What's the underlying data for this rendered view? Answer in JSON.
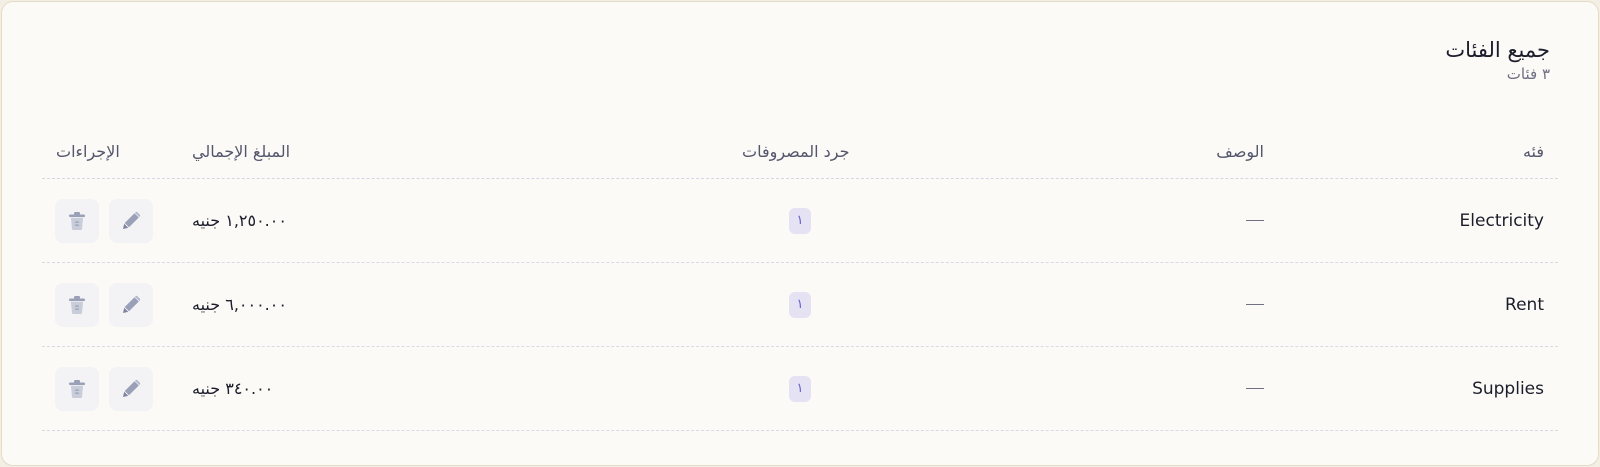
{
  "header": {
    "title": "جميع الفئات",
    "subtitle": "٣ فئات"
  },
  "table": {
    "columns": {
      "category": "فئه",
      "description": "الوصف",
      "expense_count": "جرد المصروفات",
      "total_amount": "المبلغ الإجمالي",
      "actions": "الإجراءات"
    },
    "rows": [
      {
        "category": "Electricity",
        "description": "—",
        "expense_count": "١",
        "total_amount": "١,٢٥٠.٠٠ جنيه"
      },
      {
        "category": "Rent",
        "description": "—",
        "expense_count": "١",
        "total_amount": "٦,٠٠٠.٠٠ جنيه"
      },
      {
        "category": "Supplies",
        "description": "—",
        "expense_count": "١",
        "total_amount": "٣٤٠.٠٠ جنيه"
      }
    ]
  },
  "icons": {
    "edit": "pencil-icon",
    "delete": "trash-icon"
  },
  "colors": {
    "badge_bg": "#e5e2f4",
    "badge_text": "#6a5fd0",
    "icon": "#9aa0b8"
  }
}
